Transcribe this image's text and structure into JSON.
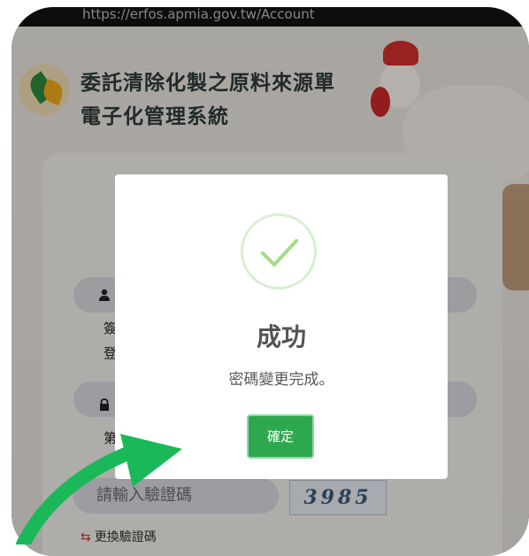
{
  "browser": {
    "url": "https://erfos.apmia.gov.tw/Account"
  },
  "header": {
    "title_line1": "委託清除化製之原料來源單",
    "title_line2": "電子化管理系統"
  },
  "login": {
    "username_hint_line1": "簽",
    "username_hint_line2": "登",
    "password_hint": "第",
    "captcha_placeholder": "請輸入驗證碼",
    "captcha_code": "3985",
    "refresh_label": "更換驗證碼"
  },
  "dialog": {
    "title": "成功",
    "message": "密碼變更完成。",
    "ok_label": "確定"
  },
  "colors": {
    "success_green": "#2ea84f",
    "check_ring": "#d8efd1",
    "annotation_arrow": "#1bb85a"
  }
}
